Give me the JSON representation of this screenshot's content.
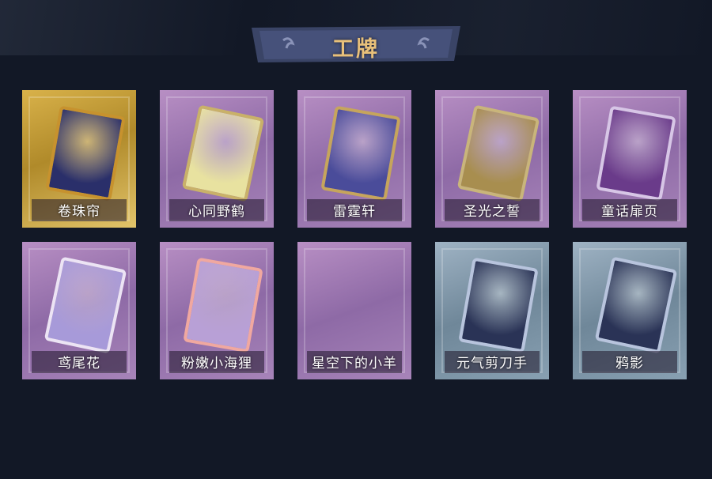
{
  "header": {
    "title": "工牌"
  },
  "cards": [
    {
      "label": "卷珠帘",
      "theme": "gold",
      "art": "curtain-card-icon",
      "art_color": "#2a2f6a",
      "art_border": "#c7922e"
    },
    {
      "label": "心同野鹤",
      "theme": "purple",
      "art": "glowing-crane-card-icon",
      "art_color": "#e8e2a0",
      "art_border": "#c9b169"
    },
    {
      "label": "雷霆轩",
      "theme": "purple",
      "art": "thunder-castle-card-icon",
      "art_color": "#4a4c9a",
      "art_border": "#c6a55c"
    },
    {
      "label": "圣光之誓",
      "theme": "purple",
      "art": "holy-light-card-icon",
      "art_color": "#a88e4f",
      "art_border": "#c9b57a"
    },
    {
      "label": "童话扉页",
      "theme": "purple",
      "art": "fairytale-curtain-card-icon",
      "art_color": "#6a3b8a",
      "art_border": "#d7c6e6"
    },
    {
      "label": "鸢尾花",
      "theme": "purple",
      "art": "iris-card-icon",
      "art_color": "#a79ad9",
      "art_border": "#ece4f4"
    },
    {
      "label": "粉嫩小海狸",
      "theme": "purple",
      "art": "pink-beaver-card-icon",
      "art_color": "#b8a0d6",
      "art_border": "#f0a8a0"
    },
    {
      "label": "星空下的小羊",
      "theme": "purple",
      "art": "empty-card-icon",
      "art_color": "",
      "art_border": ""
    },
    {
      "label": "元气剪刀手",
      "theme": "slate",
      "art": "peace-sign-silhouette-card-icon",
      "art_color": "#2a3356",
      "art_border": "#b8c4dd"
    },
    {
      "label": "鸦影",
      "theme": "slate",
      "art": "salute-silhouette-card-icon",
      "art_color": "#2a3356",
      "art_border": "#b8c4dd"
    }
  ]
}
